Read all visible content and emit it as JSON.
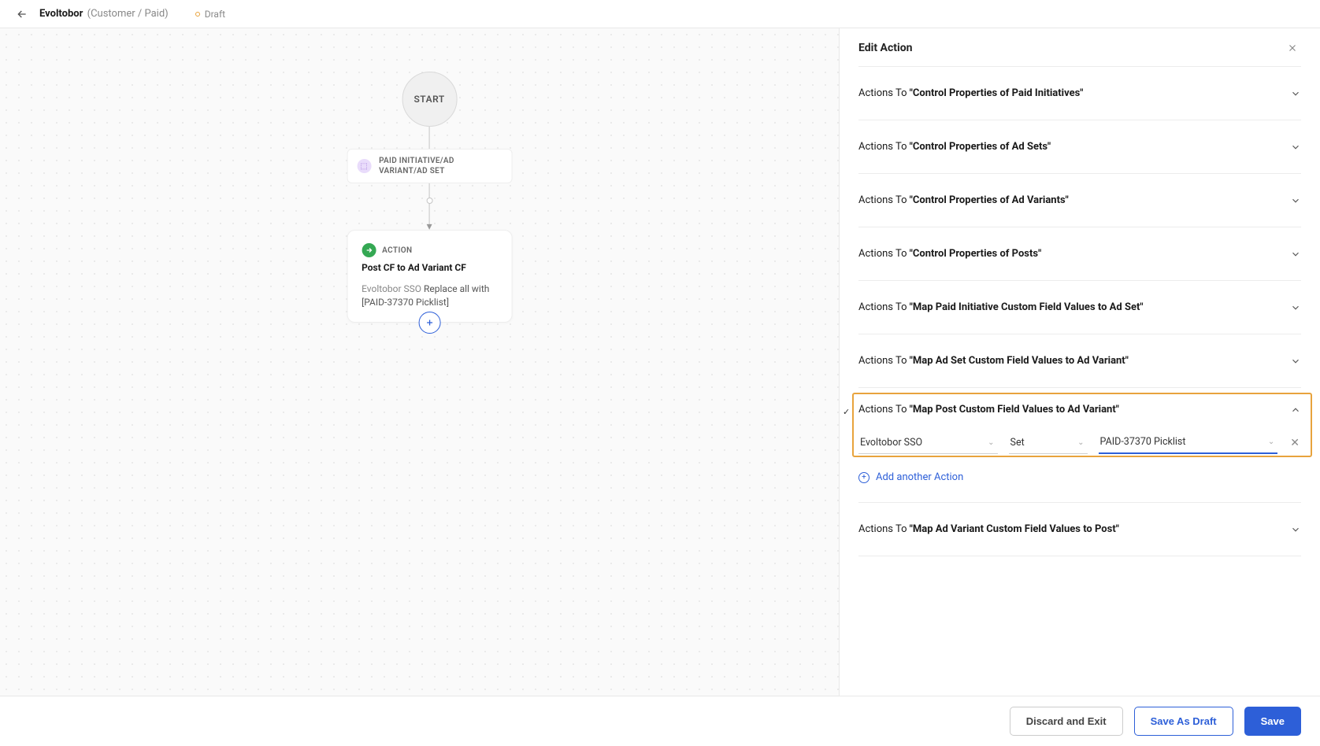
{
  "header": {
    "title": "Evoltobor",
    "subtitle": "(Customer / Paid)",
    "status": "Draft"
  },
  "canvas": {
    "start": "START",
    "trigger": "PAID INITIATIVE/AD VARIANT/AD SET",
    "action_label": "ACTION",
    "action_title": "Post CF to Ad Variant CF",
    "action_body_prefix": "Evoltobor SSO",
    "action_body_rest": " Replace all with [PAID-37370 Picklist]"
  },
  "panel": {
    "title": "Edit Action",
    "sections": [
      {
        "prefix": "Actions To ",
        "name": "\"Control Properties of Paid Initiatives\""
      },
      {
        "prefix": "Actions To ",
        "name": "\"Control Properties of Ad Sets\""
      },
      {
        "prefix": "Actions To ",
        "name": "\"Control Properties of Ad Variants\""
      },
      {
        "prefix": "Actions To ",
        "name": "\"Control Properties of Posts\""
      },
      {
        "prefix": "Actions To ",
        "name": "\"Map Paid Initiative Custom Field Values to Ad Set\""
      },
      {
        "prefix": "Actions To ",
        "name": "\"Map Ad Set Custom Field Values to Ad Variant\""
      },
      {
        "prefix": "Actions To ",
        "name": "\"Map Post Custom Field Values to Ad Variant\""
      },
      {
        "prefix": "Actions To ",
        "name": "\"Map Ad Variant Custom Field Values to Post\""
      }
    ],
    "expanded": {
      "field1": "Evoltobor SSO",
      "field2": "Set",
      "field3": "PAID-37370 Picklist",
      "add_label": "Add another Action"
    }
  },
  "footer": {
    "discard": "Discard and Exit",
    "draft": "Save As Draft",
    "save": "Save"
  }
}
